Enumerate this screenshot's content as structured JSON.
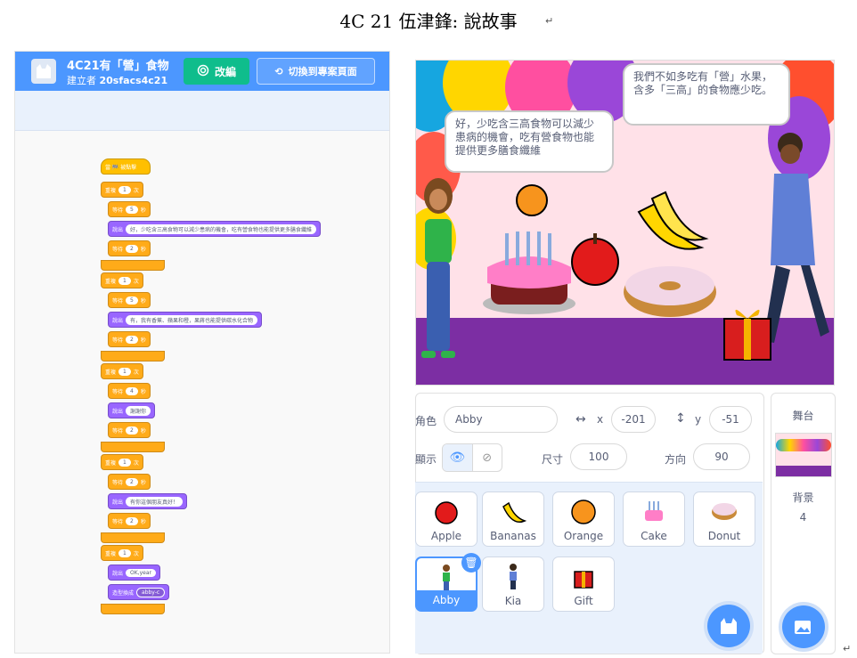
{
  "doc": {
    "title": "4C 21 伍津鋒: 說故事"
  },
  "editor": {
    "project_title": "4C21有「營」食物",
    "author_prefix": "建立者",
    "author": "20sfacs4c21",
    "remix_label": "改編",
    "see_project_label": "切換到專案頁面",
    "script": {
      "hat": "當 🏁 被點擊",
      "blocks": [
        {
          "kind": "repeat",
          "label": "重複",
          "value": "1",
          "unit": "次"
        },
        {
          "kind": "wait",
          "label": "等待",
          "value": "5",
          "unit": "秒"
        },
        {
          "kind": "say",
          "label": "說出",
          "value": "好，少吃含三高食物可以減少患病的機會，吃有營食物也能提供更多膳食纖維"
        },
        {
          "kind": "wait",
          "label": "等待",
          "value": "2",
          "unit": "秒"
        },
        {
          "kind": "repeat",
          "label": "重複",
          "value": "1",
          "unit": "次"
        },
        {
          "kind": "wait",
          "label": "等待",
          "value": "5",
          "unit": "秒"
        },
        {
          "kind": "say",
          "label": "說出",
          "value": "有，我有香蕉、蘋果和橙，果蔣也能提供碳水化合物"
        },
        {
          "kind": "wait",
          "label": "等待",
          "value": "2",
          "unit": "秒"
        },
        {
          "kind": "repeat",
          "label": "重複",
          "value": "1",
          "unit": "次"
        },
        {
          "kind": "wait",
          "label": "等待",
          "value": "4",
          "unit": "秒"
        },
        {
          "kind": "say",
          "label": "說出",
          "value": "謝謝你"
        },
        {
          "kind": "wait",
          "label": "等待",
          "value": "2",
          "unit": "秒"
        },
        {
          "kind": "repeat",
          "label": "重複",
          "value": "1",
          "unit": "次"
        },
        {
          "kind": "wait",
          "label": "等待",
          "value": "2",
          "unit": "秒"
        },
        {
          "kind": "say",
          "label": "說出",
          "value": "有你這個朋友真好！"
        },
        {
          "kind": "wait",
          "label": "等待",
          "value": "2",
          "unit": "秒"
        },
        {
          "kind": "repeat",
          "label": "重複",
          "value": "1",
          "unit": "次"
        },
        {
          "kind": "say",
          "label": "說出",
          "value": "OK,year"
        },
        {
          "kind": "costume",
          "label": "造型換成",
          "value": "abby-c"
        }
      ]
    }
  },
  "stage": {
    "bubble_left": "好，少吃含三高食物可以減少患病的機會，吃有營食物也能提供更多膳食纖維",
    "bubble_right": "我們不如多吃有「營」水果，含多「三高」的食物應少吃。"
  },
  "sprite_info": {
    "sprite_label": "角色",
    "sprite_name": "Abby",
    "x_label": "x",
    "x_value": "-201",
    "y_label": "y",
    "y_value": "-51",
    "show_label": "顯示",
    "size_label": "尺寸",
    "size_value": "100",
    "direction_label": "方向",
    "direction_value": "90"
  },
  "sprites": [
    "Apple",
    "Bananas",
    "Orange",
    "Cake",
    "Donut",
    "Abby",
    "Kia",
    "Gift"
  ],
  "stage_pane": {
    "title": "舞台",
    "backdrops_label": "背景",
    "backdrops_count": "4"
  },
  "colors": {
    "scratch_blue": "#4c97ff",
    "remix_green": "#0fbd8c",
    "control": "#ffab19",
    "looks": "#9966ff",
    "floor": "#7c2ea3"
  }
}
